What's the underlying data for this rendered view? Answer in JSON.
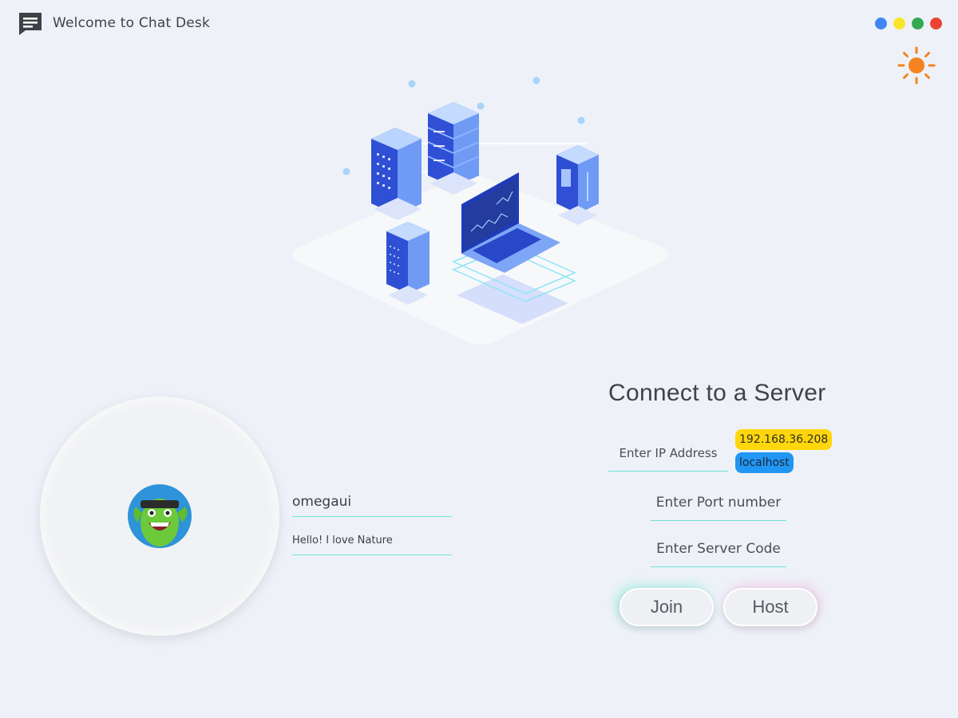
{
  "window": {
    "title": "Welcome to Chat Desk",
    "icons": {
      "app": "chat-icon",
      "theme": "sun-icon"
    },
    "dots": [
      {
        "name": "blue-dot",
        "color": "#4285f4"
      },
      {
        "name": "yellow-dot",
        "color": "#fbe52b"
      },
      {
        "name": "green-dot",
        "color": "#34a853"
      },
      {
        "name": "red-dot",
        "color": "#ea4335"
      }
    ]
  },
  "profile": {
    "username": "omegaui",
    "status": "Hello! I love Nature",
    "avatar_icon": "monster-avatar"
  },
  "connect": {
    "title": "Connect to a Server",
    "ip_placeholder": "Enter IP Address",
    "port_placeholder": "Enter Port number",
    "code_placeholder": "Enter Server Code",
    "ip_suggestions": [
      {
        "label": "192.168.36.208",
        "color": "#ffd60a"
      },
      {
        "label": "localhost",
        "color": "#2196f3"
      }
    ],
    "join_label": "Join",
    "host_label": "Host"
  },
  "colors": {
    "background": "#eef2f8",
    "field_underline": "#6ee3d6",
    "theme_icon": "#f5831f"
  }
}
